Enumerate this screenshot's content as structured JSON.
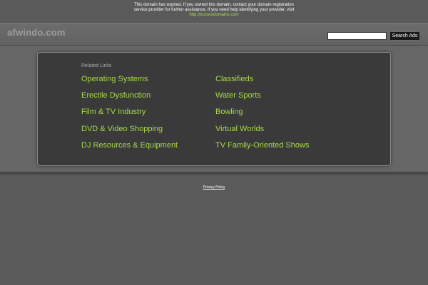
{
  "notice": {
    "line1": "This domain has expired. If you owned this domain, contact your domain registration",
    "line2": "service provider for further assistance. If you need help identifying your provider, visit",
    "link": "http://tucowsdomains.com"
  },
  "header": {
    "site_name": "afwindo.com",
    "search_placeholder": "",
    "search_value": "",
    "search_button": "Search Ads"
  },
  "related": {
    "title": "Related Links",
    "left": [
      "Operating Systems",
      "Erectile Dysfunction",
      "Film & TV Industry",
      "DVD & Video Shopping",
      "DJ Resources & Equipment"
    ],
    "right": [
      "Classifieds",
      "Water Sports",
      "Bowling",
      "Virtual Worlds",
      "TV Family-Oriented Shows"
    ]
  },
  "footer": {
    "privacy": "Privacy Policy"
  },
  "colors": {
    "background": "#5a5a5a",
    "link": "#a8d94a",
    "box": "#3a3a3a"
  }
}
